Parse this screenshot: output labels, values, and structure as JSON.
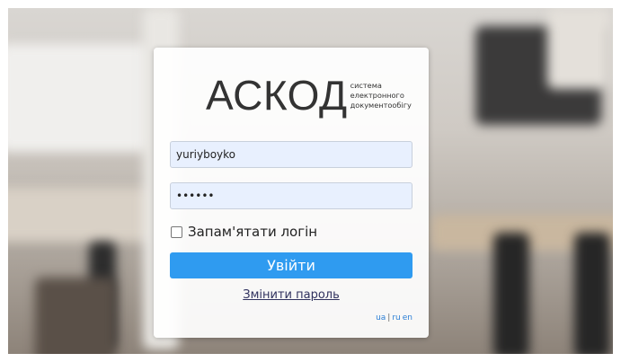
{
  "logo": {
    "main": "АСКОД",
    "sub_line1": "система",
    "sub_line2": "електронного",
    "sub_line3": "документообігу"
  },
  "login_form": {
    "username_value": "yuriyboyko",
    "password_value": "••••••",
    "remember_label": "Запам'ятати логін",
    "remember_checked": false,
    "submit_label": "Увійти",
    "change_password_link": "Змінити пароль"
  },
  "languages": {
    "ua": "ua",
    "separator": "|",
    "ru": "ru",
    "en": "en"
  },
  "colors": {
    "submit_button": "#2f9bf0",
    "input_background": "#e8f0fe",
    "link": "#30315e"
  }
}
